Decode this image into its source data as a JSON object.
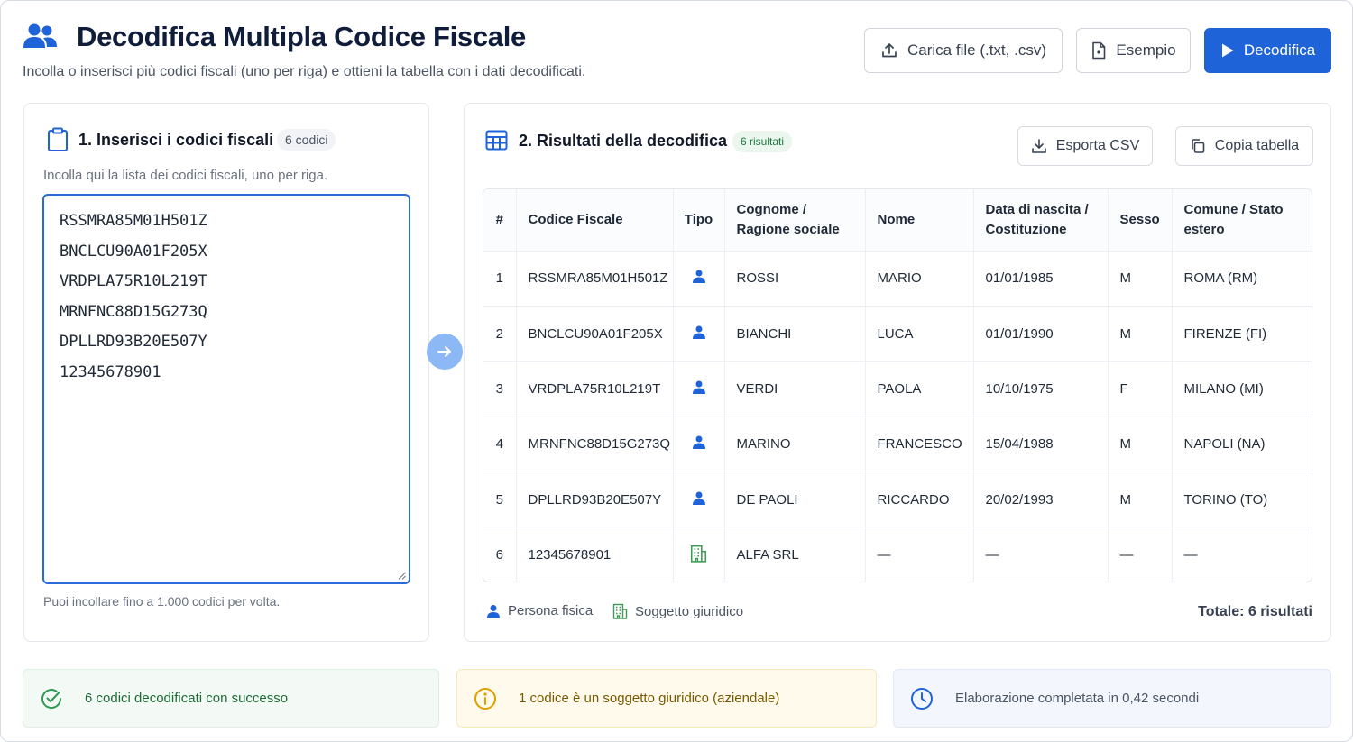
{
  "header": {
    "title": "Decodifica Multipla Codice Fiscale",
    "subtitle": "Incolla o inserisci più codici fiscali (uno per riga) e ottieni la tabella con i dati decodificati.",
    "upload_label": "Carica file (.txt, .csv)",
    "example_label": "Esempio",
    "decode_label": "Decodifica"
  },
  "left_panel": {
    "title": "1. Inserisci i codici fiscali",
    "count_badge": "6 codici",
    "help": "Incolla qui la lista dei codici fiscali, uno per riga.",
    "codes": [
      "RSSMRA85M01H501Z",
      "BNCLCU90A01F205X",
      "VRDPLA75R10L219T",
      "MRNFNC88D15G273Q",
      "DPLLRD93B20E507Y",
      "12345678901"
    ],
    "footnote": "Puoi incollare fino a 1.000 codici per volta."
  },
  "right_panel": {
    "title": "2. Risultati della decodifica",
    "count_badge": "6 risultati",
    "export_label": "Esporta CSV",
    "copy_label": "Copia tabella",
    "columns": [
      "#",
      "Codice Fiscale",
      "Tipo",
      "Cognome / Ragione sociale",
      "Nome",
      "Data di nascita / Costituzione",
      "Sesso",
      "Comune / Stato estero"
    ],
    "rows": [
      {
        "idx": "1",
        "code": "RSSMRA85M01H501Z",
        "type_icon": "person-icon",
        "surname": "ROSSI",
        "name": "MARIO",
        "date": "01/01/1985",
        "sex": "M",
        "place": "ROMA (RM)"
      },
      {
        "idx": "2",
        "code": "BNCLCU90A01F205X",
        "type_icon": "person-icon",
        "surname": "BIANCHI",
        "name": "LUCA",
        "date": "01/01/1990",
        "sex": "M",
        "place": "FIRENZE (FI)"
      },
      {
        "idx": "3",
        "code": "VRDPLA75R10L219T",
        "type_icon": "person-icon",
        "surname": "VERDI",
        "name": "PAOLA",
        "date": "10/10/1975",
        "sex": "F",
        "place": "MILANO (MI)"
      },
      {
        "idx": "4",
        "code": "MRNFNC88D15G273Q",
        "type_icon": "person-icon",
        "surname": "MARINO",
        "name": "FRANCESCO",
        "date": "15/04/1988",
        "sex": "M",
        "place": "NAPOLI (NA)"
      },
      {
        "idx": "5",
        "code": "DPLLRD93B20E507Y",
        "type_icon": "person-icon",
        "surname": "DE PAOLI",
        "name": "RICCARDO",
        "date": "20/02/1993",
        "sex": "M",
        "place": "TORINO (TO)"
      },
      {
        "idx": "6",
        "code": "12345678901",
        "type_icon": "building-icon",
        "surname": "ALFA SRL",
        "name": "—",
        "date": "—",
        "sex": "—",
        "place": "—"
      }
    ],
    "legend_person": "Persona fisica",
    "legend_company": "Soggetto giuridico",
    "total": "Totale: 6 risultati"
  },
  "status": {
    "success": "6 codici decodificati con successo",
    "warning": "1 codice è un soggetto giuridico (aziendale)",
    "info": "Elaborazione completata in 0,42 secondi"
  },
  "colors": {
    "primary": "#1f63d8",
    "success": "#2e9a52",
    "warning": "#e0a100",
    "company_icon": "#3f9a56"
  }
}
